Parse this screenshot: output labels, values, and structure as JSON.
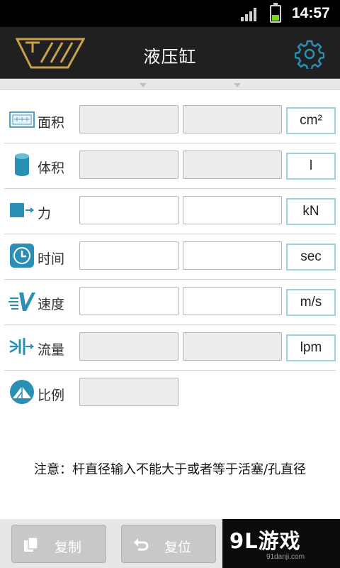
{
  "status_bar": {
    "time": "14:57"
  },
  "header": {
    "title": "液压缸",
    "icons": [
      "logo",
      "gear-icon"
    ]
  },
  "rows": [
    {
      "key": "area",
      "label": "面积",
      "icon": "area-icon",
      "field1": "",
      "field2": "",
      "unit": "cm²"
    },
    {
      "key": "volume",
      "label": "体积",
      "icon": "cylinder-icon",
      "field1": "",
      "field2": "",
      "unit": "l"
    },
    {
      "key": "force",
      "label": "力",
      "icon": "force-arrow-icon",
      "field1": "",
      "field2": "",
      "unit": "kN"
    },
    {
      "key": "time",
      "label": "时间",
      "icon": "clock-icon",
      "field1": "",
      "field2": "",
      "unit": "sec"
    },
    {
      "key": "speed",
      "label": "速度",
      "icon": "speed-icon",
      "field1": "",
      "field2": "",
      "unit": "m/s"
    },
    {
      "key": "flow",
      "label": "流量",
      "icon": "flow-icon",
      "field1": "",
      "field2": "",
      "unit": "lpm"
    },
    {
      "key": "ratio",
      "label": "比例",
      "icon": "ratio-icon",
      "field1": ""
    }
  ],
  "note": "注意：杆直径输入不能大于或者等于活塞/孔直径",
  "toolbar": {
    "copy_label": "复制",
    "reset_label": "复位"
  },
  "watermark": {
    "main": "9L游戏",
    "sub": "91danji.com"
  },
  "colors": {
    "header_bg": "#202020",
    "accent": "#2a8fb4",
    "unit_border": "#9dd0e2",
    "logo": "#c8a24a",
    "label": "#333333"
  }
}
